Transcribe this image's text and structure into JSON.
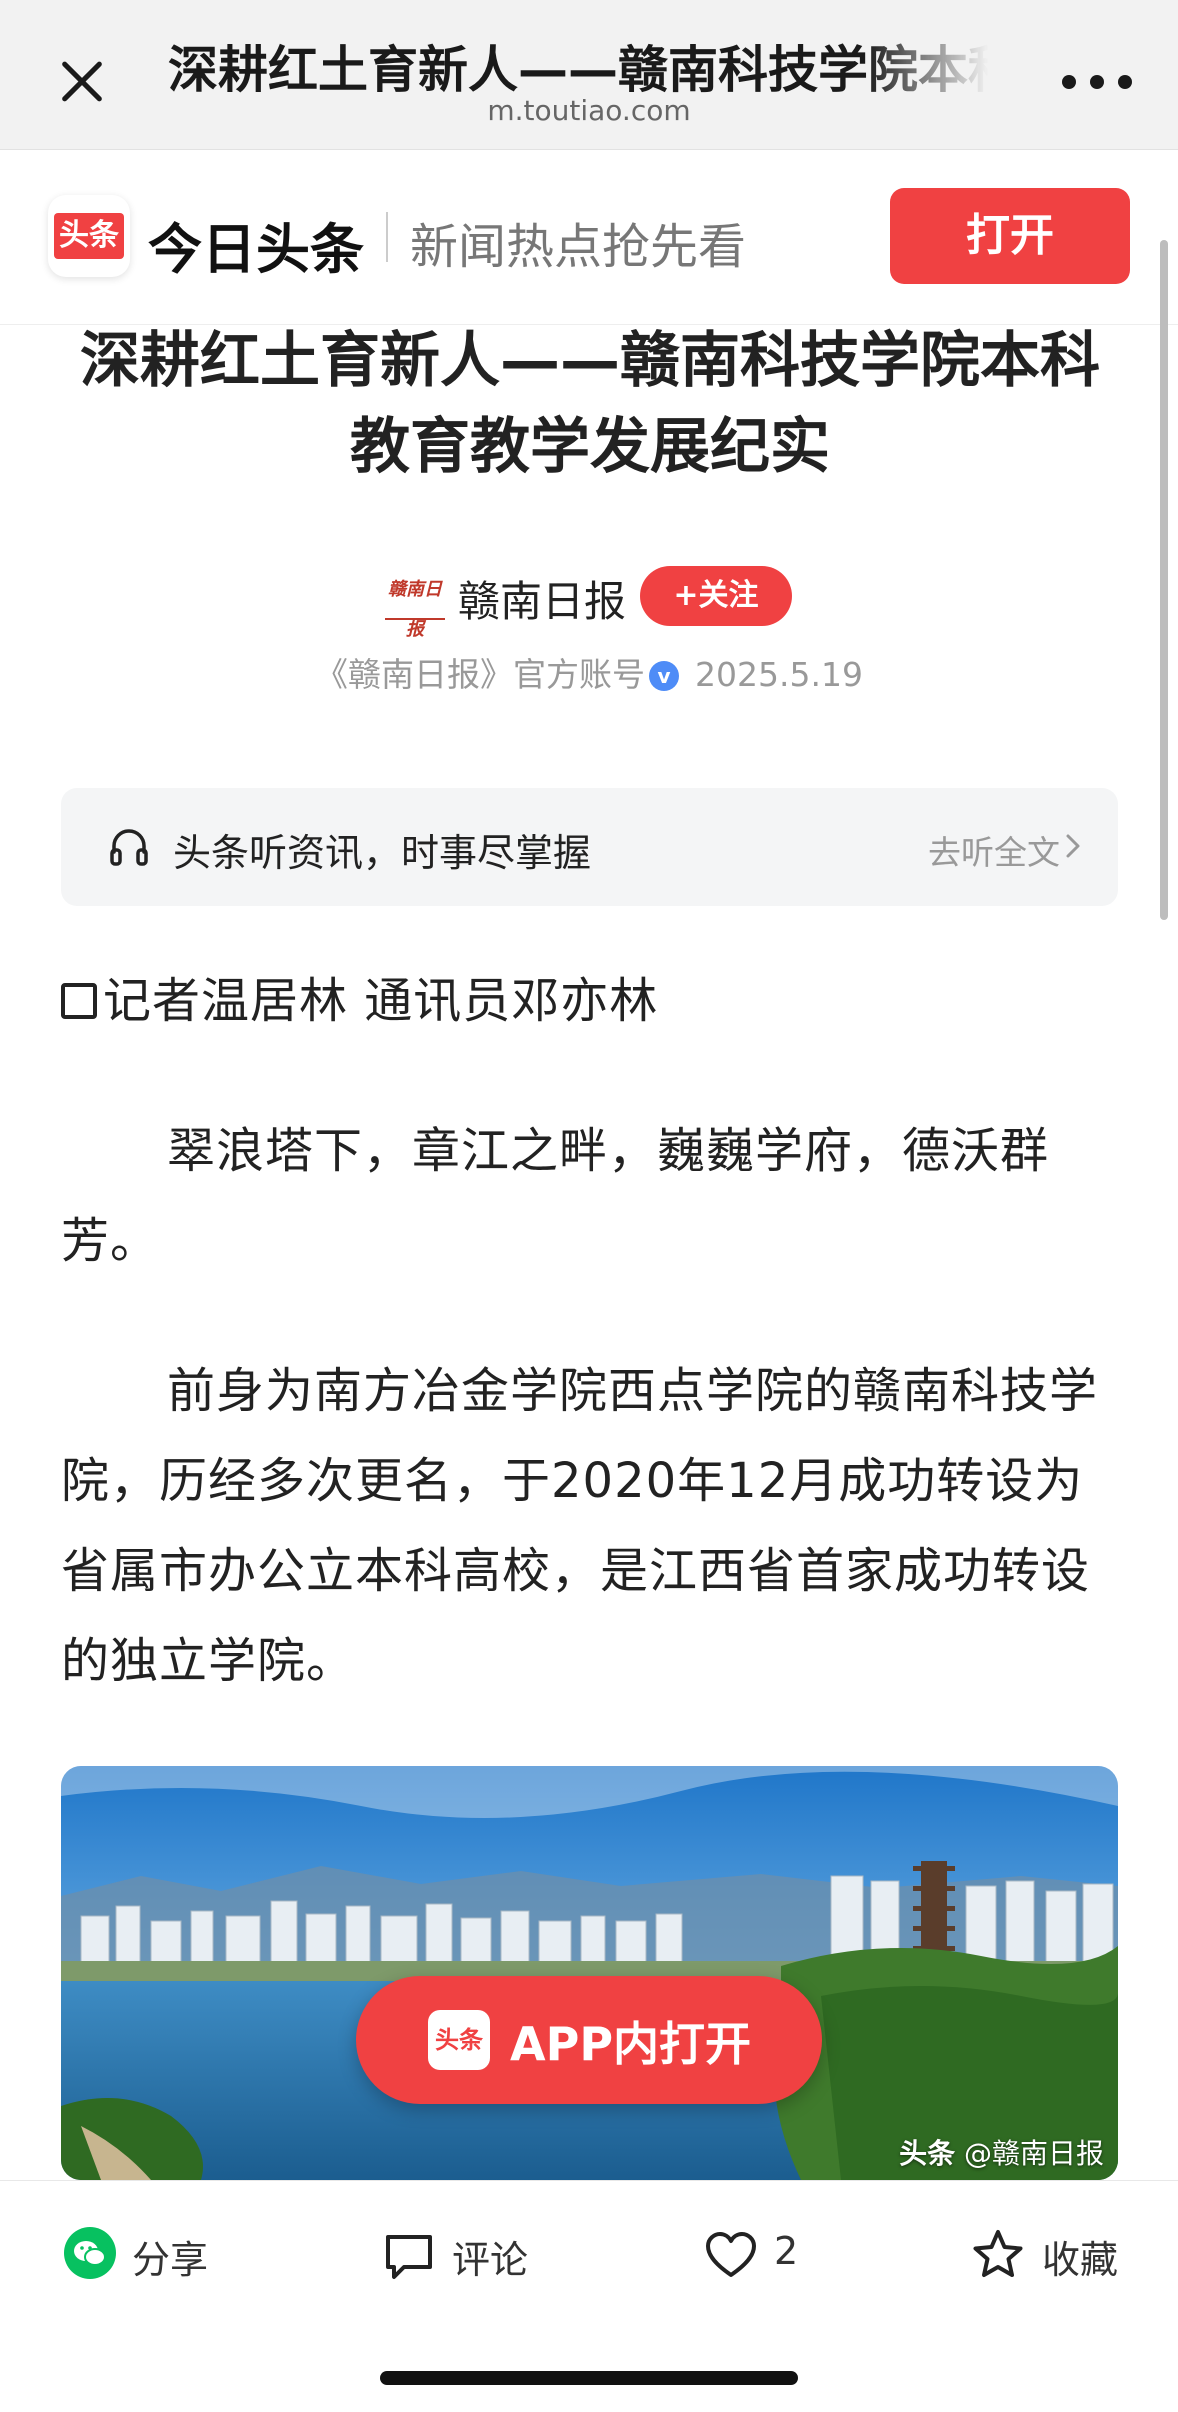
{
  "topbar": {
    "title": "深耕红土育新人——赣南科技学院本科",
    "url": "m.toutiao.com"
  },
  "banner": {
    "logo_text": "头条",
    "brand": "今日头条",
    "slogan": "新闻热点抢先看",
    "open_label": "打开",
    "accent_color": "#f04142"
  },
  "article": {
    "title": "深耕红土育新人——赣南科技学院本科教育教学发展纪实",
    "author": {
      "logo_text": "赣南日报",
      "name": "赣南日报",
      "follow_label": "+关注",
      "account": "《赣南日报》官方账号",
      "verified_mark": "v",
      "date": "2025.5.19"
    },
    "listen": {
      "text": "头条听资讯，时事尽掌握",
      "link": "去听全文"
    },
    "byline": "记者温居林 通讯员邓亦林",
    "paragraphs": [
      "翠浪塔下，章江之畔，巍巍学府，德沃群芳。",
      "前身为南方冶金学院西点学院的赣南科技学院，历经多次更名，于2020年12月成功转设为省属市办公立本科高校，是江西省首家成功转设的独立学院。"
    ],
    "image": {
      "watermark_brand": "头条",
      "watermark_source": "@赣南日报"
    },
    "app_open": {
      "logo_text": "头条",
      "label": "APP内打开"
    }
  },
  "bottom_bar": {
    "share_label": "分享",
    "comment_label": "评论",
    "like_count": "2",
    "favorite_label": "收藏"
  }
}
